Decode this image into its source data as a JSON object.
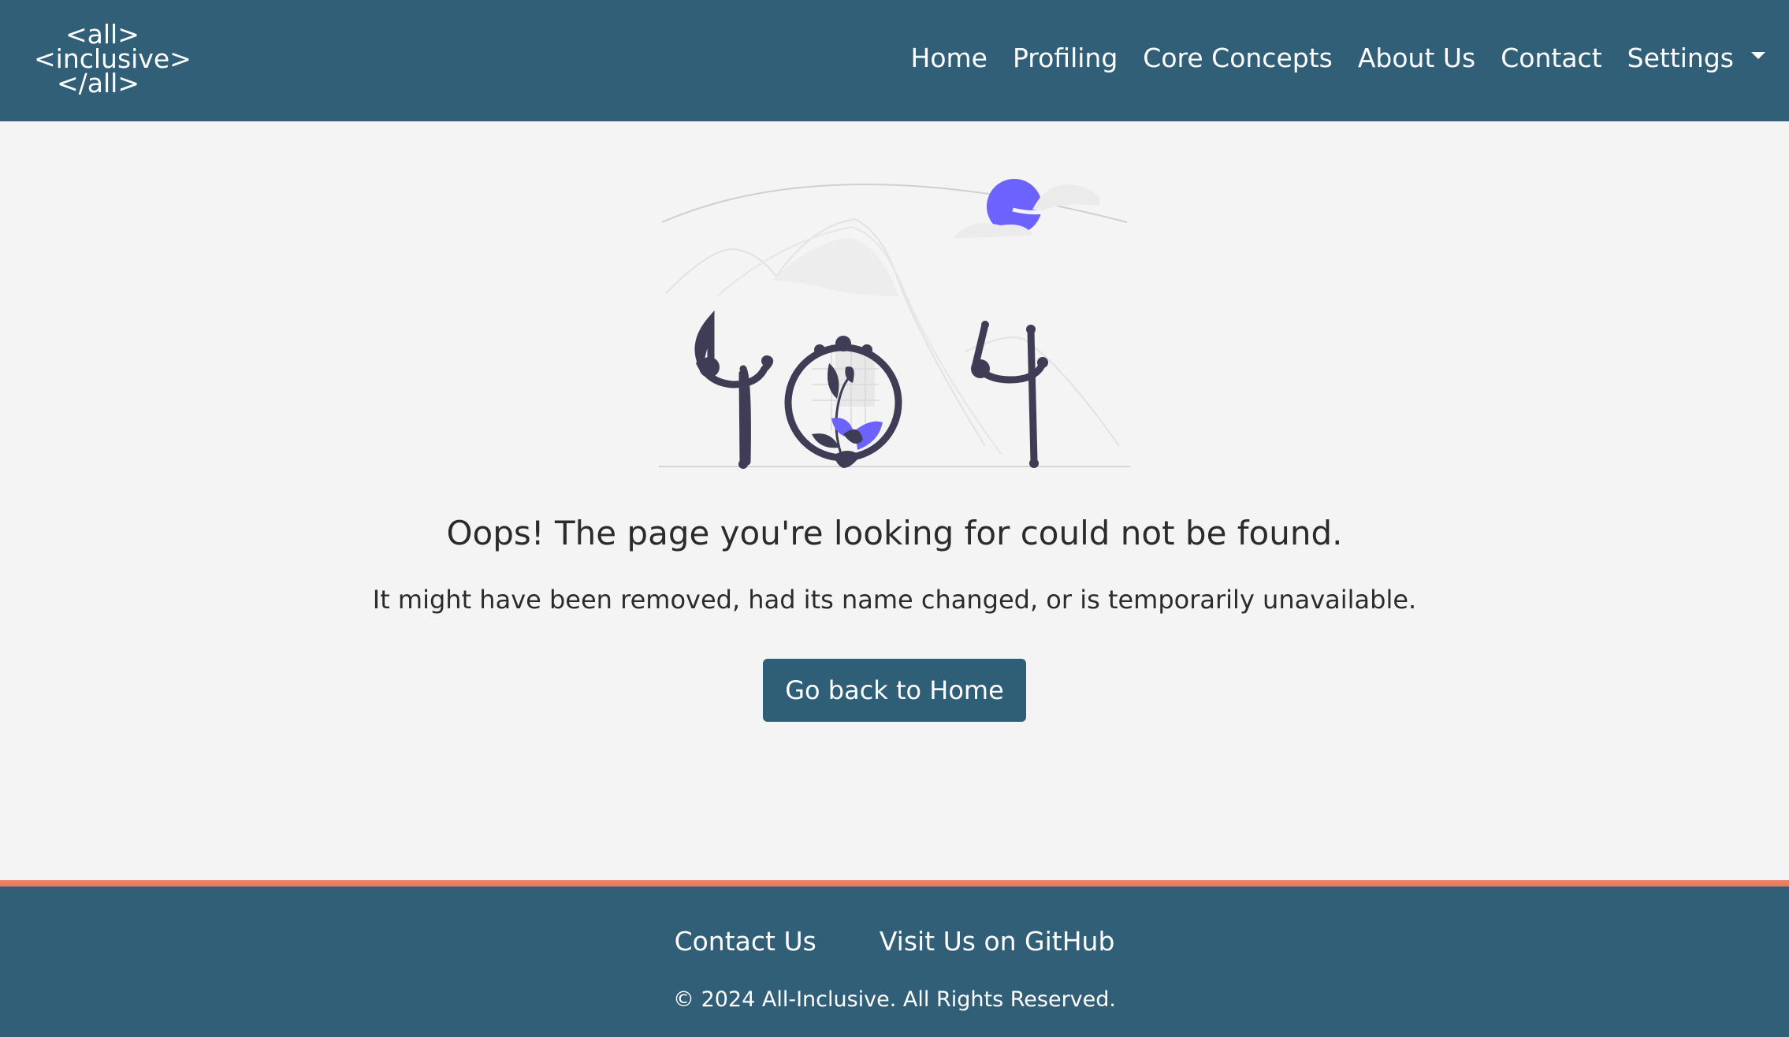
{
  "brand": {
    "logo_line1": "<all>",
    "logo_line2": "<inclusive>",
    "logo_line3": "</all>"
  },
  "nav": {
    "items": [
      {
        "label": "Home"
      },
      {
        "label": "Profiling"
      },
      {
        "label": "Core Concepts"
      },
      {
        "label": "About Us"
      },
      {
        "label": "Contact"
      },
      {
        "label": "Settings"
      }
    ]
  },
  "main": {
    "title": "Oops! The page you're looking for could not be found.",
    "message": "It might have been removed, had its name changed, or is temporarily unavailable.",
    "button_label": "Go back to Home",
    "illustration": "404-not-found-illustration"
  },
  "footer": {
    "links": [
      {
        "label": "Contact Us"
      },
      {
        "label": "Visit Us on GitHub"
      }
    ],
    "copyright": "© 2024 All-Inclusive. All Rights Reserved."
  },
  "colors": {
    "header_bg": "#315f78",
    "footer_accent": "#e8805f",
    "page_bg": "#f4f4f4",
    "illustration_accent": "#6c63ff",
    "illustration_dark": "#3f3d56"
  }
}
